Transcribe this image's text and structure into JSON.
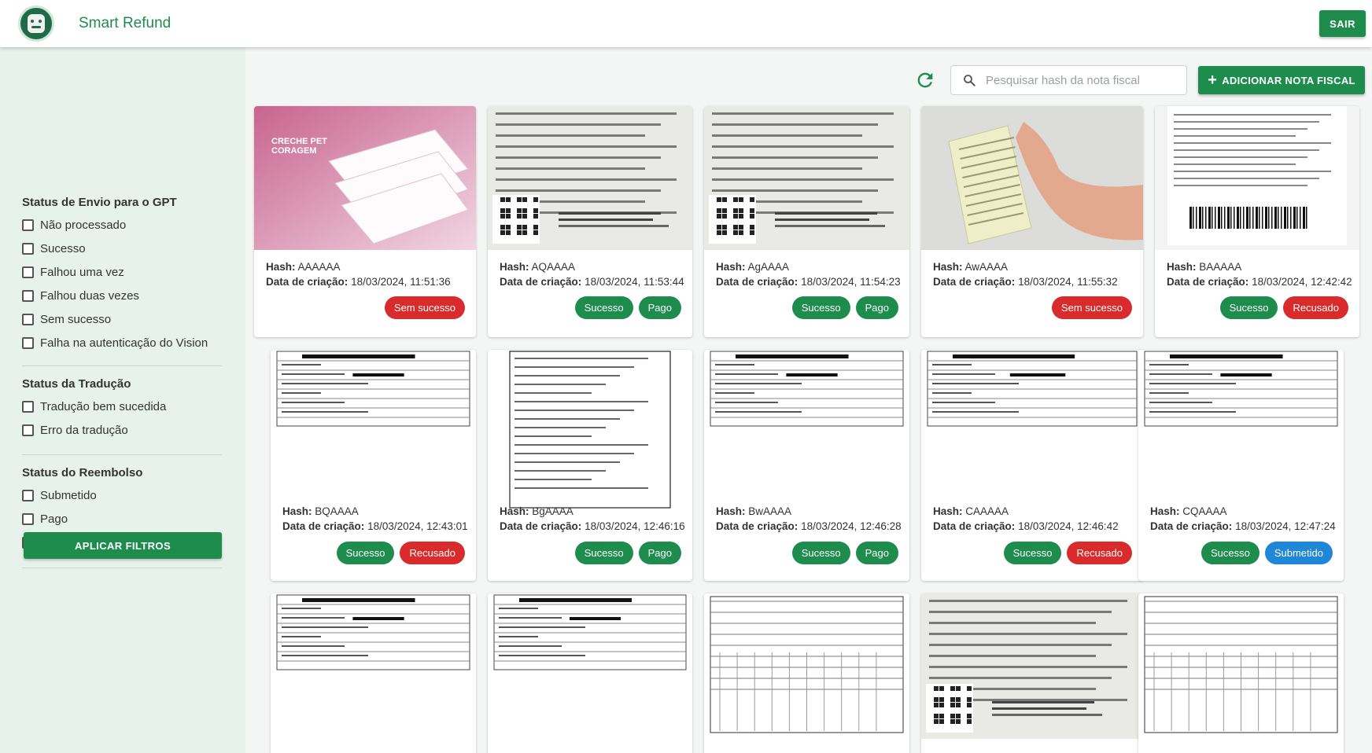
{
  "header": {
    "app_title": "Smart Refund",
    "logout_label": "SAIR"
  },
  "sidebar": {
    "groups": [
      {
        "title": "Status de Envio para o GPT",
        "options": [
          "Não processado",
          "Sucesso",
          "Falhou uma vez",
          "Falhou duas vezes",
          "Sem sucesso",
          "Falha na autenticação do Vision"
        ]
      },
      {
        "title": "Status da Tradução",
        "options": [
          "Tradução bem sucedida",
          "Erro da tradução"
        ]
      },
      {
        "title": "Status do Reembolso",
        "options": [
          "Submetido",
          "Pago",
          "Recusado"
        ]
      }
    ],
    "apply_label": "APLICAR FILTROS"
  },
  "toolbar": {
    "search_placeholder": "Pesquisar hash da nota fiscal",
    "add_label": "ADICIONAR NOTA FISCAL"
  },
  "labels": {
    "hash": "Hash:",
    "created": "Data de criação:"
  },
  "colors": {
    "primary": "#1e8c4c",
    "danger": "#d92b2b",
    "info": "#1f87d8",
    "sidebar_bg": "#e6f2eb"
  },
  "cards": [
    {
      "hash": "AAAAAA",
      "date": "18/03/2024, 11:51:36",
      "image": "creche",
      "chips": [
        {
          "label": "Sem sucesso",
          "color": "red"
        }
      ]
    },
    {
      "hash": "AQAAAA",
      "date": "18/03/2024, 11:53:44",
      "image": "receipt-qr",
      "chips": [
        {
          "label": "Sucesso",
          "color": "green"
        },
        {
          "label": "Pago",
          "color": "green"
        }
      ]
    },
    {
      "hash": "AgAAAA",
      "date": "18/03/2024, 11:54:23",
      "image": "receipt-qr",
      "chips": [
        {
          "label": "Sucesso",
          "color": "green"
        },
        {
          "label": "Pago",
          "color": "green"
        }
      ]
    },
    {
      "hash": "AwAAAA",
      "date": "18/03/2024, 11:55:32",
      "image": "hand-receipt",
      "chips": [
        {
          "label": "Sem sucesso",
          "color": "red"
        }
      ]
    },
    {
      "hash": "BAAAAA",
      "date": "18/03/2024, 12:42:42",
      "image": "cupom",
      "chips": [
        {
          "label": "Sucesso",
          "color": "green"
        },
        {
          "label": "Recusado",
          "color": "red"
        }
      ]
    },
    {
      "hash": "BQAAAA",
      "date": "18/03/2024, 12:43:01",
      "image": "nota-form",
      "chips": [
        {
          "label": "Sucesso",
          "color": "green"
        },
        {
          "label": "Recusado",
          "color": "red"
        }
      ]
    },
    {
      "hash": "BgAAAA",
      "date": "18/03/2024, 12:46:16",
      "image": "service-doc",
      "chips": [
        {
          "label": "Sucesso",
          "color": "green"
        },
        {
          "label": "Pago",
          "color": "green"
        }
      ]
    },
    {
      "hash": "BwAAAA",
      "date": "18/03/2024, 12:46:28",
      "image": "nota-form",
      "chips": [
        {
          "label": "Sucesso",
          "color": "green"
        },
        {
          "label": "Pago",
          "color": "green"
        }
      ]
    },
    {
      "hash": "CAAAAA",
      "date": "18/03/2024, 12:46:42",
      "image": "nota-form",
      "chips": [
        {
          "label": "Sucesso",
          "color": "green"
        },
        {
          "label": "Recusado",
          "color": "red"
        }
      ]
    },
    {
      "hash": "CQAAAA",
      "date": "18/03/2024, 12:47:24",
      "image": "nota-form",
      "chips": [
        {
          "label": "Sucesso",
          "color": "green"
        },
        {
          "label": "Submetido",
          "color": "blue"
        }
      ]
    },
    {
      "hash": "",
      "date": "",
      "image": "nota-form",
      "chips": []
    },
    {
      "hash": "",
      "date": "",
      "image": "nota-form",
      "chips": []
    },
    {
      "hash": "",
      "date": "",
      "image": "grid-doc",
      "chips": []
    },
    {
      "hash": "",
      "date": "",
      "image": "receipt-qr",
      "chips": []
    },
    {
      "hash": "",
      "date": "",
      "image": "grid-doc",
      "chips": []
    }
  ]
}
